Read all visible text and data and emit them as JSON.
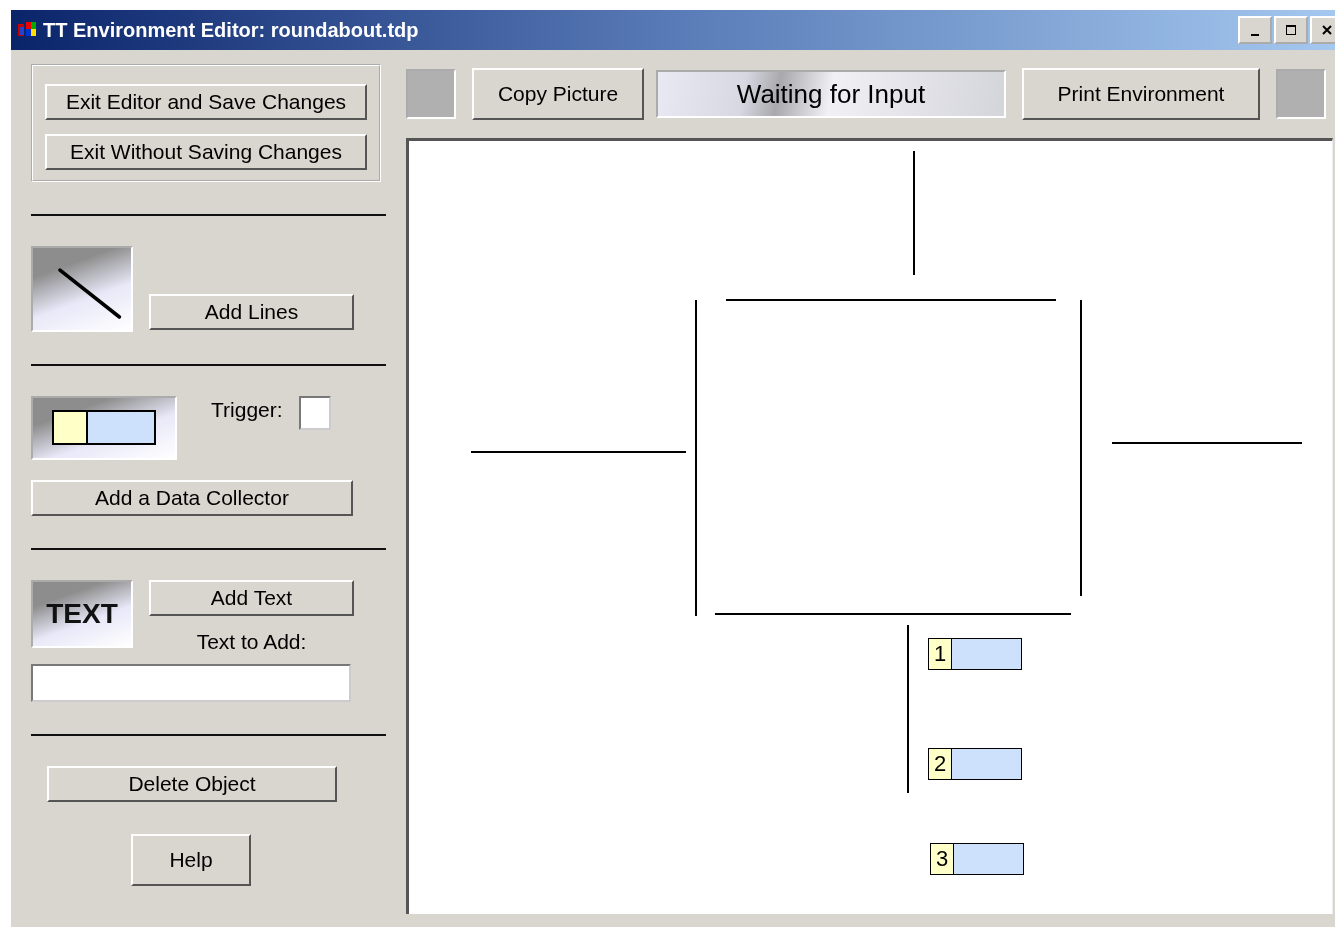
{
  "window": {
    "title": "TT Environment Editor:  roundabout.tdp"
  },
  "file_buttons": [
    "Exit Editor and Save Changes",
    "Exit Without Saving Changes"
  ],
  "lines_tool": {
    "button": "Add Lines"
  },
  "collector_tool": {
    "trigger_label": "Trigger:",
    "trigger_checked": false,
    "button": "Add a Data Collector"
  },
  "text_tool": {
    "icon_text": "TEXT",
    "button": "Add Text",
    "field_label": "Text to Add:"
  },
  "delete_button": "Delete Object",
  "help_button": "Help",
  "toolbar": {
    "copy_button": "Copy Picture",
    "status": "Waiting for Input",
    "print_button": "Print Environment"
  },
  "collectors": [
    {
      "label": "1"
    },
    {
      "label": "2"
    },
    {
      "label": "3"
    }
  ]
}
